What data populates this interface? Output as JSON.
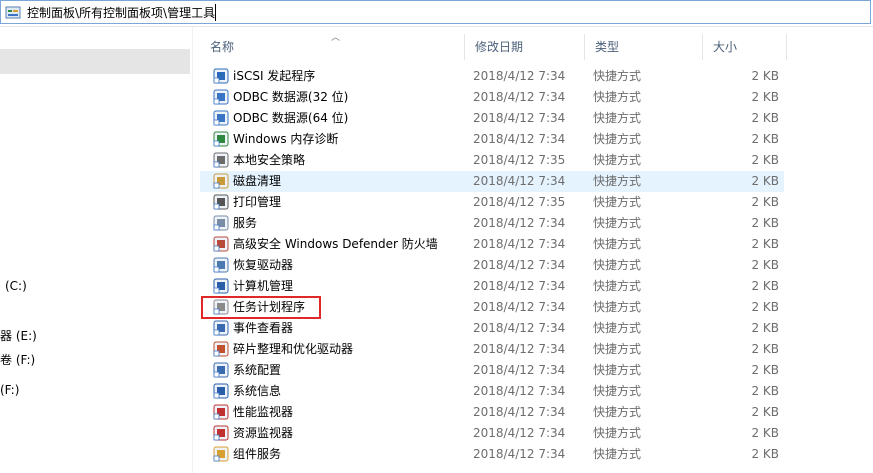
{
  "address": {
    "path": "控制面板\\所有控制面板项\\管理工具"
  },
  "nav": {
    "items": [
      {
        "label": "(C:)"
      },
      {
        "label": "器 (E:)"
      },
      {
        "label": "卷 (F:)"
      },
      {
        "label": "(F:)"
      }
    ]
  },
  "columns": {
    "name": "名称",
    "date": "修改日期",
    "type": "类型",
    "size": "大小"
  },
  "files": [
    {
      "name": "iSCSI 发起程序",
      "date": "2018/4/12 7:34",
      "type": "快捷方式",
      "size": "2 KB",
      "icon": "iscsi-icon",
      "color": "#2a6ab8"
    },
    {
      "name": "ODBC 数据源(32 位)",
      "date": "2018/4/12 7:34",
      "type": "快捷方式",
      "size": "2 KB",
      "icon": "odbc-icon",
      "color": "#3a74c4"
    },
    {
      "name": "ODBC 数据源(64 位)",
      "date": "2018/4/12 7:34",
      "type": "快捷方式",
      "size": "2 KB",
      "icon": "odbc-icon",
      "color": "#3a74c4"
    },
    {
      "name": "Windows 内存诊断",
      "date": "2018/4/12 7:34",
      "type": "快捷方式",
      "size": "2 KB",
      "icon": "memory-diagnostic-icon",
      "color": "#2d8a3c"
    },
    {
      "name": "本地安全策略",
      "date": "2018/4/12 7:35",
      "type": "快捷方式",
      "size": "2 KB",
      "icon": "security-policy-icon",
      "color": "#6b6b6b"
    },
    {
      "name": "磁盘清理",
      "date": "2018/4/12 7:34",
      "type": "快捷方式",
      "size": "2 KB",
      "icon": "disk-cleanup-icon",
      "color": "#c89a3a"
    },
    {
      "name": "打印管理",
      "date": "2018/4/12 7:35",
      "type": "快捷方式",
      "size": "2 KB",
      "icon": "printer-icon",
      "color": "#555555"
    },
    {
      "name": "服务",
      "date": "2018/4/12 7:34",
      "type": "快捷方式",
      "size": "2 KB",
      "icon": "services-gear-icon",
      "color": "#7a8da6"
    },
    {
      "name": "高级安全 Windows Defender 防火墙",
      "date": "2018/4/12 7:34",
      "type": "快捷方式",
      "size": "2 KB",
      "icon": "firewall-icon",
      "color": "#b84a3a"
    },
    {
      "name": "恢复驱动器",
      "date": "2018/4/12 7:34",
      "type": "快捷方式",
      "size": "2 KB",
      "icon": "recovery-drive-icon",
      "color": "#4a7ab0"
    },
    {
      "name": "计算机管理",
      "date": "2018/4/12 7:34",
      "type": "快捷方式",
      "size": "2 KB",
      "icon": "computer-management-icon",
      "color": "#2a5ea8"
    },
    {
      "name": "任务计划程序",
      "date": "2018/4/12 7:34",
      "type": "快捷方式",
      "size": "2 KB",
      "icon": "task-scheduler-icon",
      "color": "#8a8a8a"
    },
    {
      "name": "事件查看器",
      "date": "2018/4/12 7:34",
      "type": "快捷方式",
      "size": "2 KB",
      "icon": "event-viewer-icon",
      "color": "#3a6ab0"
    },
    {
      "name": "碎片整理和优化驱动器",
      "date": "2018/4/12 7:34",
      "type": "快捷方式",
      "size": "2 KB",
      "icon": "defrag-icon",
      "color": "#c0502e"
    },
    {
      "name": "系统配置",
      "date": "2018/4/12 7:34",
      "type": "快捷方式",
      "size": "2 KB",
      "icon": "system-config-icon",
      "color": "#3a6ab0"
    },
    {
      "name": "系统信息",
      "date": "2018/4/12 7:34",
      "type": "快捷方式",
      "size": "2 KB",
      "icon": "system-info-icon",
      "color": "#2a5ea8"
    },
    {
      "name": "性能监视器",
      "date": "2018/4/12 7:34",
      "type": "快捷方式",
      "size": "2 KB",
      "icon": "performance-monitor-icon",
      "color": "#c0302e"
    },
    {
      "name": "资源监视器",
      "date": "2018/4/12 7:34",
      "type": "快捷方式",
      "size": "2 KB",
      "icon": "resource-monitor-icon",
      "color": "#c0302e"
    },
    {
      "name": "组件服务",
      "date": "2018/4/12 7:34",
      "type": "快捷方式",
      "size": "2 KB",
      "icon": "component-services-icon",
      "color": "#d8a030"
    }
  ],
  "hover_index": 5,
  "highlight_index": 11
}
